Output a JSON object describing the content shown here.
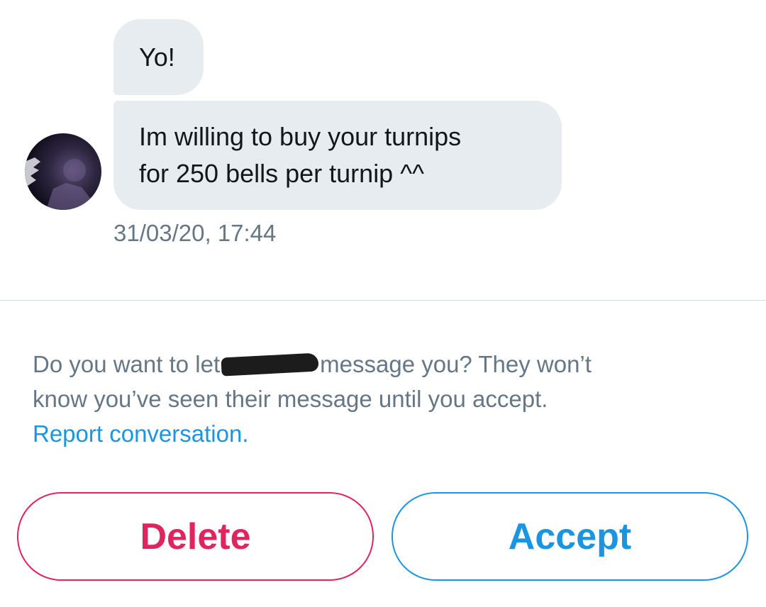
{
  "conversation": {
    "messages": [
      {
        "text": "Yo!"
      },
      {
        "line1": "Im willing to buy your turnips",
        "line2": "for 250 bells per turnip ^^"
      }
    ],
    "timestamp": "31/03/20, 17:44"
  },
  "request": {
    "prompt_before": "Do you want to let",
    "prompt_after": "message you? They won’t",
    "prompt_line2": "know you’ve seen their message until you accept.",
    "report_link": "Report conversation."
  },
  "actions": {
    "delete_label": "Delete",
    "accept_label": "Accept"
  },
  "colors": {
    "bubble": "#e6ecf0",
    "secondary_text": "#657786",
    "link": "#1b95e0",
    "delete": "#e0245e",
    "accept": "#1b95e0"
  }
}
